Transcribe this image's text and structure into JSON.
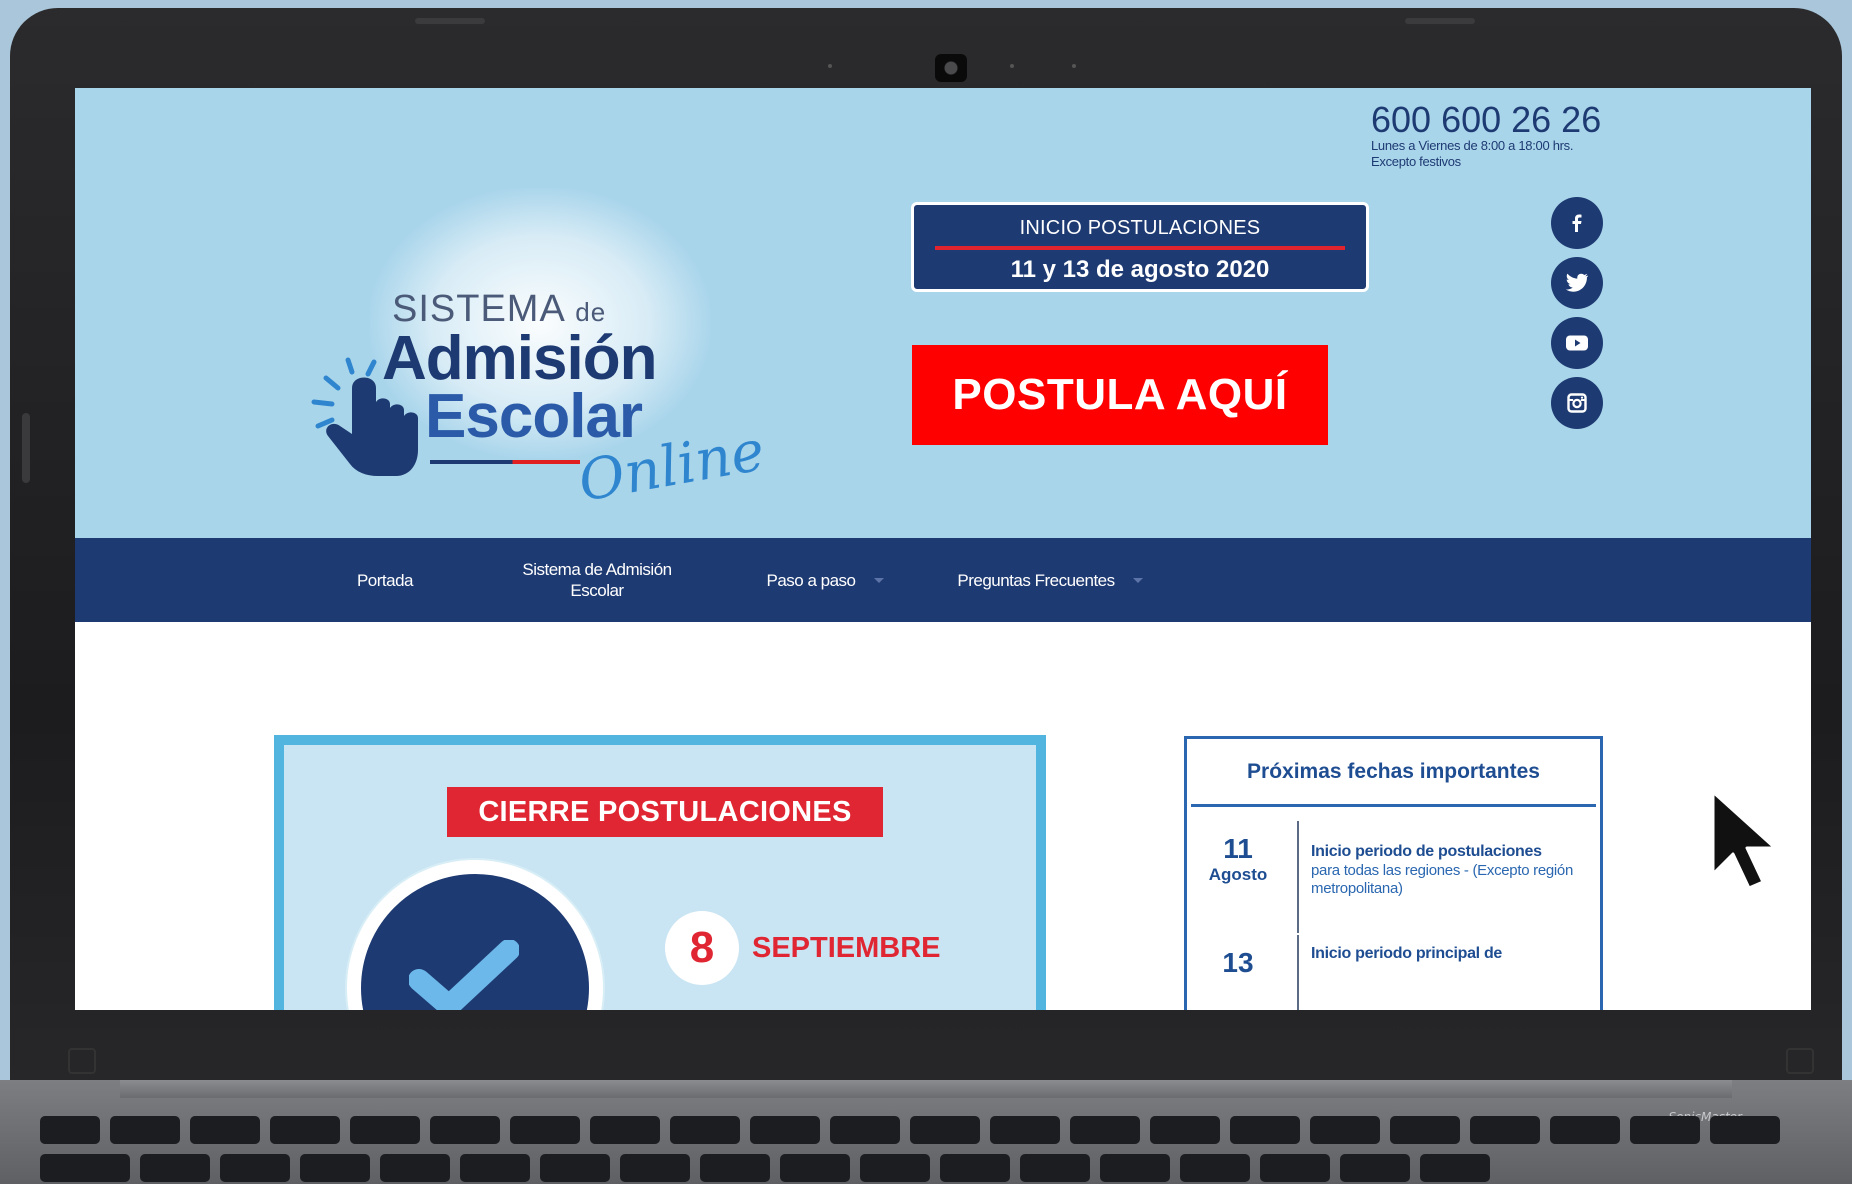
{
  "header": {
    "phone_number": "600 600 26 26",
    "phone_hours": "Lunes a Viernes de 8:00 a 18:00 hrs.",
    "phone_except": "Excepto festivos"
  },
  "logo": {
    "line1": "SISTEMA",
    "line1_de": "de",
    "line2": "Admisión",
    "line3": "Escolar",
    "line4": "Online"
  },
  "date_box": {
    "title": "INICIO POSTULACIONES",
    "dates": "11 y 13 de agosto 2020"
  },
  "apply_button": {
    "label": "POSTULA AQUÍ"
  },
  "social": [
    {
      "icon": "facebook-icon"
    },
    {
      "icon": "twitter-icon"
    },
    {
      "icon": "youtube-icon"
    },
    {
      "icon": "instagram-icon"
    }
  ],
  "nav": {
    "items": [
      {
        "label": "Portada"
      },
      {
        "label": "Sistema de Admisión Escolar"
      },
      {
        "label": "Paso a paso"
      },
      {
        "label": "Preguntas Frecuentes"
      }
    ]
  },
  "banner": {
    "title": "CIERRE POSTULACIONES",
    "day": "8",
    "month": "SEPTIEMBRE"
  },
  "important_dates": {
    "title": "Próximas fechas importantes",
    "entries": [
      {
        "day": "11",
        "month": "Agosto",
        "head": "Inicio periodo de postulaciones",
        "desc": "para todas las regiones - (Excepto región metropolitana)"
      },
      {
        "day": "13",
        "head": "Inicio periodo principal de"
      }
    ]
  },
  "keyboard": {
    "brand": "SonicMaster"
  },
  "colors": {
    "header_bg": "#a9d5eb",
    "navy": "#1e3a72",
    "red": "#ff0000",
    "banner_border": "#51b5e0"
  }
}
